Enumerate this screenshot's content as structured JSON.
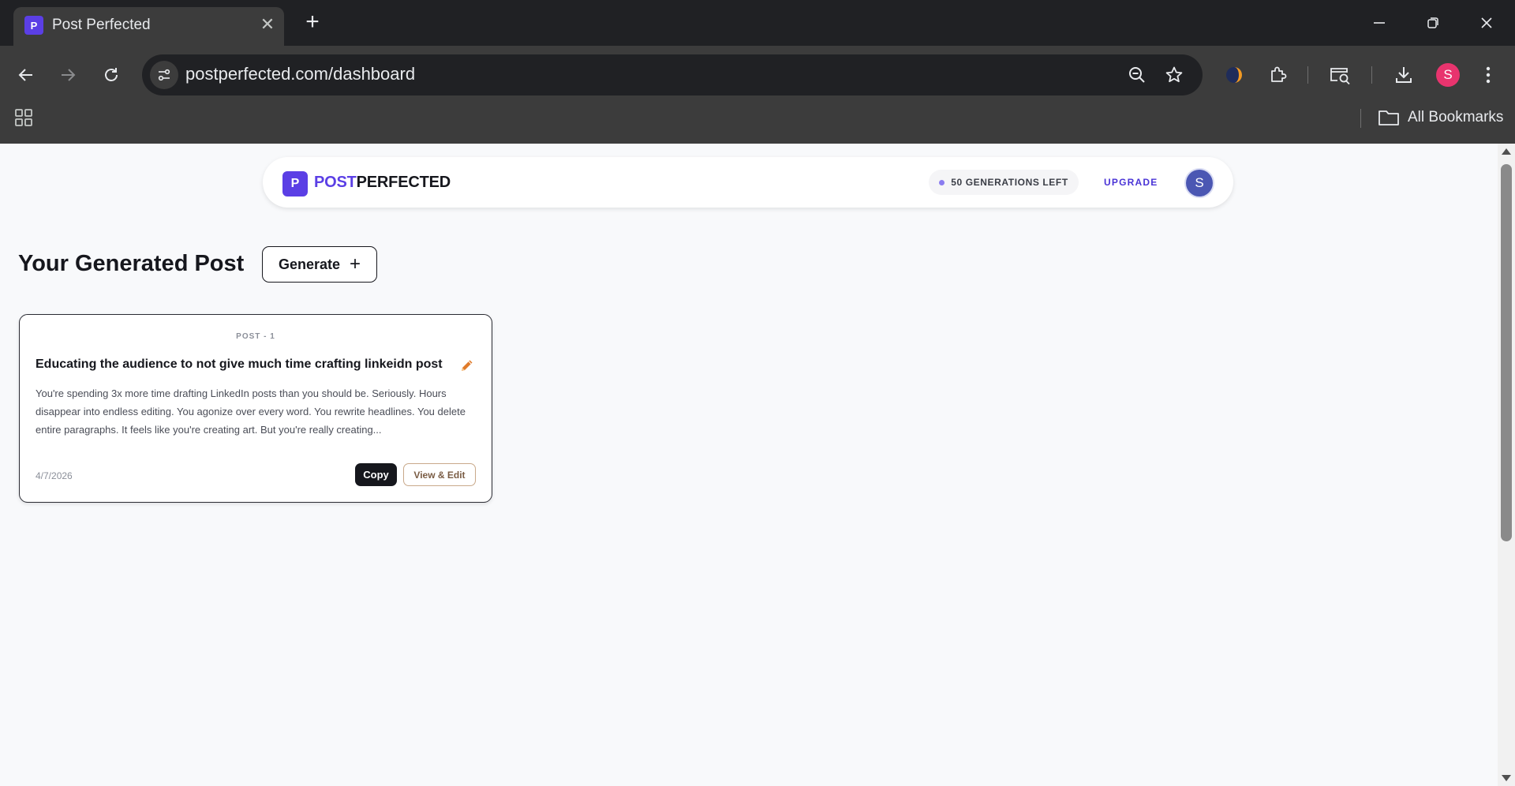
{
  "browser": {
    "tab_title": "Post Perfected",
    "tab_favicon_letter": "P",
    "url": "postperfected.com/dashboard",
    "profile_letter": "S",
    "bookmarks_label": "All Bookmarks"
  },
  "header": {
    "logo_letter": "P",
    "logo_part1": "POST",
    "logo_part2": "PERFECTED",
    "generations_left": "50 GENERATIONS LEFT",
    "upgrade_label": "UPGRADE",
    "user_initial": "S"
  },
  "main": {
    "title": "Your Generated Post",
    "generate_label": "Generate"
  },
  "posts": [
    {
      "tag": "POST - 1",
      "title": "Educating the audience to not give much time crafting linkeidn post",
      "excerpt": "You're spending 3x more time drafting LinkedIn posts than you should be. Seriously. Hours disappear into endless editing. You agonize over every word. You rewrite headlines. You delete entire paragraphs. It feels like you're creating art. But you're really creating...",
      "date": "4/7/2026",
      "copy_label": "Copy",
      "view_label": "View & Edit"
    }
  ],
  "colors": {
    "brand": "#5b3fe5",
    "dark": "#16171d",
    "edit_icon": "#e07b2a"
  }
}
